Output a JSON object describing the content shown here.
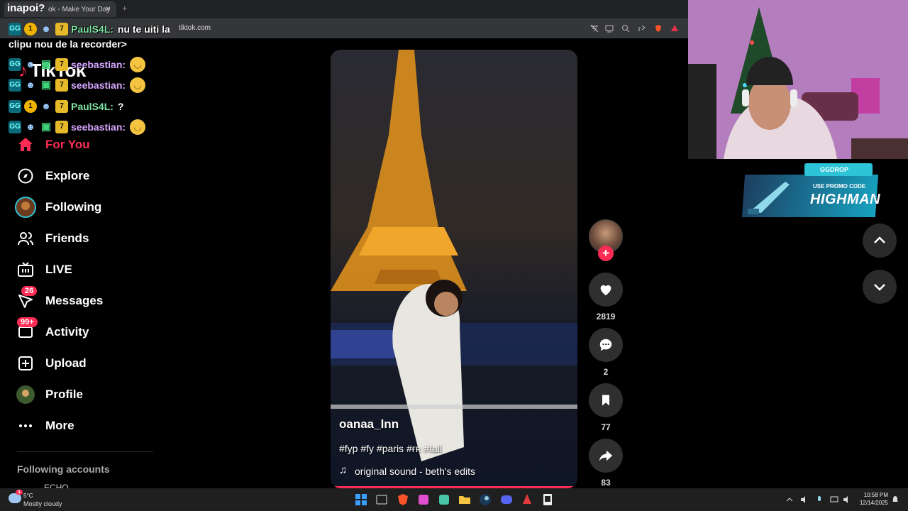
{
  "browser": {
    "tab_title": "ok - Make Your Day",
    "tab_close": "×",
    "new_tab": "+",
    "url": "tiktok.com"
  },
  "stream": {
    "channel_title": "inapoi?"
  },
  "tiktok": {
    "logo": "TikTok",
    "nav": [
      {
        "label": "For You",
        "icon": "home-icon",
        "active": true
      },
      {
        "label": "Explore",
        "icon": "compass-icon"
      },
      {
        "label": "Following",
        "icon": "following-avatar-icon"
      },
      {
        "label": "Friends",
        "icon": "friends-icon"
      },
      {
        "label": "LIVE",
        "icon": "live-tv-icon"
      },
      {
        "label": "Messages",
        "icon": "messages-icon",
        "badge": "26"
      },
      {
        "label": "Activity",
        "icon": "activity-icon",
        "badge": "99+"
      },
      {
        "label": "Upload",
        "icon": "upload-icon"
      },
      {
        "label": "Profile",
        "icon": "profile-avatar-icon"
      },
      {
        "label": "More",
        "icon": "more-dots-icon"
      }
    ],
    "following_accounts_heading": "Following accounts",
    "following_partial": "ECHO"
  },
  "video": {
    "author": "oanaa_lnn",
    "caption": "#fyp #fy #paris #ғʀ #fall",
    "sound": "original sound - beth's edits",
    "likes": "2819",
    "comments": "2",
    "saves": "77",
    "shares": "83"
  },
  "promo": {
    "brand": "GGDROP",
    "line1": "USE PROMO CODE",
    "code": "HIGHMAN"
  },
  "chat": {
    "lines": [
      {
        "name": "PaulS4L:",
        "msg": "nu te uiti la",
        "color": "#7fe3a3"
      },
      {
        "name": "seebastian:",
        "msg": "",
        "color": "#d7a6ff"
      },
      {
        "name": "seebastian:",
        "msg": "",
        "color": "#d7a6ff"
      },
      {
        "name": "PaulS4L:",
        "msg": "?",
        "color": "#7fe3a3"
      },
      {
        "name": "seebastian:",
        "msg": "",
        "color": "#d7a6ff"
      }
    ],
    "wrap_text": "clipu nou de la recorder>",
    "badge_one": "1",
    "badge_gg": "GG",
    "badge_seven": "7"
  },
  "taskbar": {
    "weather_temp": "5°C",
    "weather_desc": "Mostly cloudy",
    "weather_alert": "1",
    "time": "10:58 PM",
    "date": "12/14/2025"
  },
  "colors": {
    "accent": "#fe2c55",
    "panel": "#2f2f2f"
  }
}
